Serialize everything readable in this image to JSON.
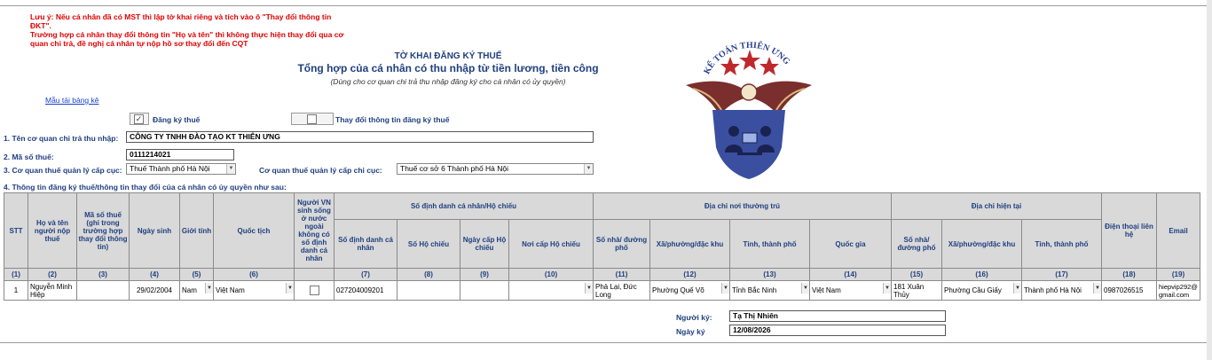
{
  "notes": [
    "Lưu ý: Nếu cá nhân đã có MST thì lập tờ khai riêng và tích vào ô \"Thay đổi thông tin ĐKT\".",
    "Trường hợp cá nhân thay đổi thông tin \"Họ và tên\" thì không thực hiện thay đổi qua cơ quan chi trả, đề nghị cá nhân tự nộp hồ sơ thay đổi đến CQT"
  ],
  "title": {
    "line1": "TỜ KHAI ĐĂNG KÝ THUẾ",
    "line2": "Tổng hợp của cá nhân có thu nhập từ tiền lương, tiền công",
    "line3": "(Dùng cho cơ quan chi trả thu nhập đăng ký cho cá nhân có ủy quyền)"
  },
  "template_link": "Mẫu tải bảng kê",
  "checkboxes": {
    "register": {
      "label": "Đăng ký thuế",
      "checked": true,
      "mark": "✓"
    },
    "change": {
      "label": "Thay đổi thông tin đăng ký thuế",
      "checked": false,
      "mark": ""
    }
  },
  "fields": {
    "payer_label": "1. Tên cơ quan chi trả thu nhập:",
    "payer_value": "CÔNG TY TNHH ĐÀO TẠO KT THIÊN ƯNG",
    "tax_code_label": "2. Mã số thuế:",
    "tax_code_value": "0111214021",
    "dept_label": "3. Cơ quan thuế quản lý cấp cục:",
    "dept_value": "Thuế Thành phố Hà Nội",
    "subdept_label": "Cơ quan thuế quản lý cấp chi cục:",
    "subdept_value": "Thuế cơ sở 6 Thành phố Hà Nội",
    "section4_label": "4. Thông tin đăng ký thuế/thông tin thay đổi của cá nhân có ủy quyền như sau:"
  },
  "table": {
    "headers": {
      "stt": "STT",
      "name": "Họ và tên người nộp thuế",
      "mst": "Mã số thuế (ghi trong trường hợp thay đổi thông tin)",
      "dob": "Ngày sinh",
      "gender": "Giới tính",
      "nationality": "Quốc tịch",
      "abroad": "Người VN sinh sống ở nước ngoài không có số định danh cá nhân",
      "id_group": "Số định danh cá nhân/Hộ chiếu",
      "id_no": "Số định danh cá nhân",
      "passport_no": "Số Hộ chiếu",
      "passport_date": "Ngày cấp Hộ chiếu",
      "passport_place": "Nơi cấp Hộ chiếu",
      "perm_group": "Địa chỉ nơi thường trú",
      "perm_house": "Số nhà/ đường phố",
      "perm_ward": "Xã/phường/đặc khu",
      "perm_city": "Tỉnh, thành phố",
      "perm_country": "Quốc gia",
      "cur_group": "Địa chỉ hiện tại",
      "cur_house": "Số nhà/ đường phố",
      "cur_ward": "Xã/phường/đặc khu",
      "cur_city": "Tỉnh, thành phố",
      "phone": "Điện thoại liên hệ",
      "email": "Email"
    },
    "col_numbers": [
      "(1)",
      "(2)",
      "(3)",
      "(4)",
      "(5)",
      "(6)",
      "",
      "(7)",
      "(8)",
      "(9)",
      "(10)",
      "(11)",
      "(12)",
      "(13)",
      "(14)",
      "(15)",
      "(16)",
      "(17)",
      "(18)",
      "(19)"
    ],
    "row": {
      "stt": "1",
      "name": "Nguyễn Minh Hiệp",
      "mst": "",
      "dob": "29/02/2004",
      "gender": "Nam",
      "nationality": "Việt Nam",
      "id_no": "027204009201",
      "passport_no": "",
      "passport_date": "",
      "passport_place": "",
      "perm_house": "Phả Lại, Đức Long",
      "perm_ward": "Phường Quế Võ",
      "perm_city": "Tỉnh Bắc Ninh",
      "perm_country": "Việt Nam",
      "cur_house": "181 Xuân Thủy",
      "cur_ward": "Phường Cầu Giấy",
      "cur_city": "Thành phố Hà Nội",
      "phone": "0987026515",
      "email": "hiepvip292@gmail.com"
    }
  },
  "signer": {
    "label": "Người ký:",
    "value": "Tạ Thị Nhiên",
    "date_label": "Ngày ký",
    "date_value": "12/08/2026"
  },
  "logo": {
    "text": "KẾ TOÁN THIÊN ƯNG",
    "colors": {
      "ring": "#2a3f8f",
      "wing": "#6b2a2a",
      "star": "#c0282d",
      "shield": "#3a4fa0"
    }
  },
  "icons": {
    "dropdown": "▼",
    "checkbox": "☐"
  }
}
